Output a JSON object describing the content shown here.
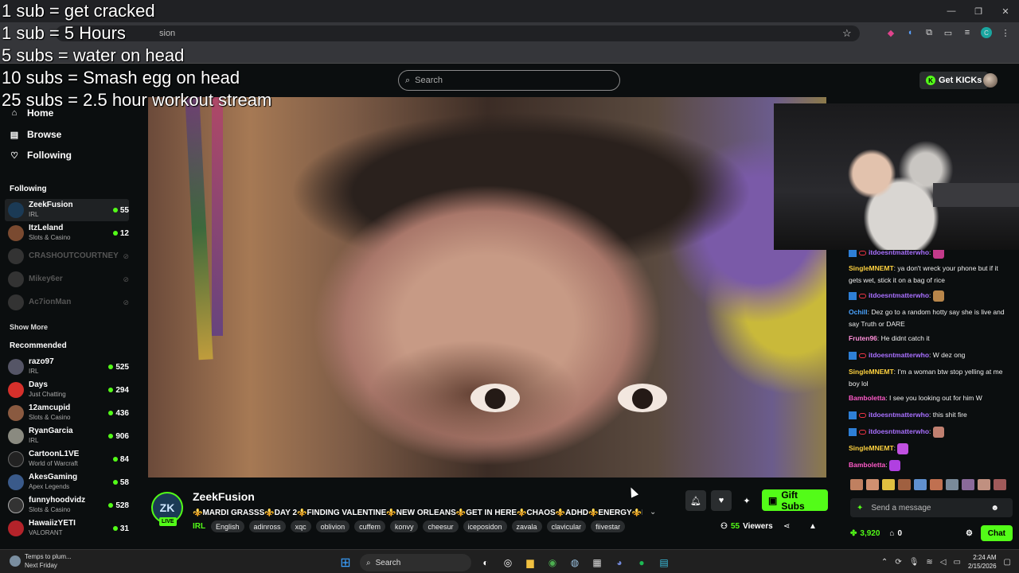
{
  "overlay_goals": [
    "1 sub = get cracked",
    "1 sub = 5 Hours",
    "5 subs = water on head",
    "10 subs = Smash egg on head",
    "25 subs = 2.5 hour workout stream"
  ],
  "browser": {
    "address_fragment": "sion"
  },
  "header": {
    "search_placeholder": "Search",
    "get_kicks_label": "Get KICKs"
  },
  "sidebar": {
    "nav": [
      {
        "label": "Home"
      },
      {
        "label": "Browse"
      },
      {
        "label": "Following"
      }
    ],
    "following_title": "Following",
    "following": [
      {
        "name": "ZeekFusion",
        "category": "IRL",
        "viewers": "55"
      },
      {
        "name": "ItzLeland",
        "category": "Slots & Casino",
        "viewers": "12"
      },
      {
        "name": "CRASHOUTCOURTNEY"
      },
      {
        "name": "Mikey6er"
      },
      {
        "name": "Ac7ionMan"
      }
    ],
    "show_more": "Show More",
    "recommended_title": "Recommended",
    "recommended": [
      {
        "name": "razo97",
        "category": "IRL",
        "viewers": "525"
      },
      {
        "name": "Days",
        "category": "Just Chatting",
        "viewers": "294"
      },
      {
        "name": "12amcupid",
        "category": "Slots & Casino",
        "viewers": "436"
      },
      {
        "name": "RyanGarcia",
        "category": "IRL",
        "viewers": "906"
      },
      {
        "name": "CartoonL1VE",
        "category": "World of Warcraft",
        "viewers": "84"
      },
      {
        "name": "AkesGaming",
        "category": "Apex Legends",
        "viewers": "58"
      },
      {
        "name": "funnyhoodvidz",
        "category": "Slots & Casino",
        "viewers": "528"
      },
      {
        "name": "HawaiizYETI",
        "category": "VALORANT",
        "viewers": "31"
      }
    ]
  },
  "stream": {
    "channel": "ZeekFusion",
    "live_badge": "LIVE",
    "title": "⚜️MARDI GRASSS⚜️DAY 2⚜️FINDING VALENTINE⚜️NEW ORLEANS⚜️GET IN HERE⚜️CHAOS⚜️ADHD⚜️ENERGY⚜️RIZZ...",
    "category": "IRL",
    "tags": [
      "English",
      "adinross",
      "xqc",
      "oblivion",
      "cuffem",
      "konvy",
      "cheesur",
      "iceposidon",
      "zavala",
      "clavicular",
      "fiivestar"
    ],
    "gift_subs_label": "Gift Subs",
    "viewers_count": "55",
    "viewers_label": "Viewers"
  },
  "chat": {
    "messages": [
      {
        "user": "itdoesntmatterwho",
        "text": "",
        "color": "#a970ff",
        "badges": true
      },
      {
        "user": "SingleMNEMT",
        "text": "ya don't wreck your phone but if it gets wet, stick it on a bag of rice",
        "color": "#ffd23f",
        "badges": false
      },
      {
        "user": "itdoesntmatterwho",
        "text": "",
        "color": "#a970ff",
        "badges": true
      },
      {
        "user": "Ochill",
        "text": "Dez go to a random hotty say she is live and say Truth or DARE",
        "color": "#4aa3ff",
        "badges": false
      },
      {
        "user": "Fruten96",
        "text": "He didnt catch it",
        "color": "#ff8fd8",
        "badges": false
      },
      {
        "user": "itdoesntmatterwho",
        "text": "W dez ong",
        "color": "#a970ff",
        "badges": true
      },
      {
        "user": "SingleMNEMT",
        "text": "I'm a woman btw stop yelling at me boy lol",
        "color": "#ffd23f",
        "badges": false
      },
      {
        "user": "Bamboletta",
        "text": "I see you looking out for him W",
        "color": "#ff5ac8",
        "badges": false
      },
      {
        "user": "itdoesntmatterwho",
        "text": "this shit fire",
        "color": "#a970ff",
        "badges": true
      },
      {
        "user": "itdoesntmatterwho",
        "text": "",
        "color": "#a970ff",
        "badges": true
      },
      {
        "user": "SingleMNEMT",
        "text": "",
        "color": "#ffd23f",
        "badges": false
      },
      {
        "user": "Bamboletta",
        "text": "",
        "color": "#ff5ac8",
        "badges": false
      }
    ],
    "send_placeholder": "Send a message",
    "points": "3,920",
    "other_count": "0",
    "chat_button": "Chat"
  },
  "taskbar": {
    "weather_line1": "Temps to plum...",
    "weather_line2": "Next Friday",
    "search_label": "Search",
    "time": "2:24 AM",
    "date": "2/15/2026"
  }
}
